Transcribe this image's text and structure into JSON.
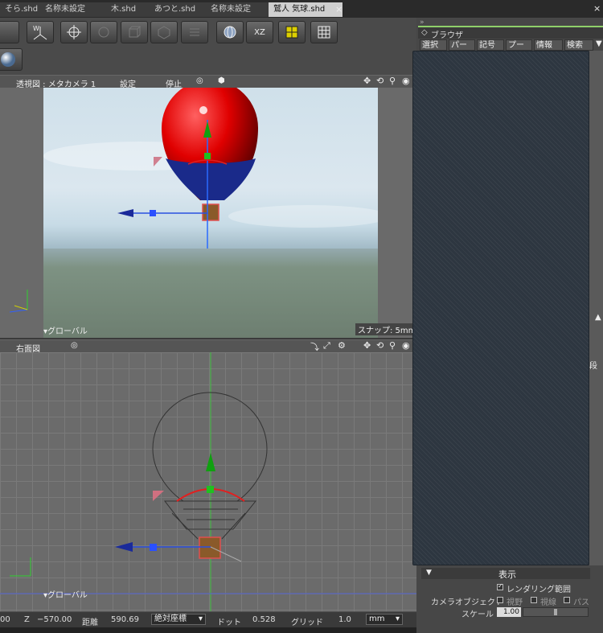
{
  "tabs": [
    {
      "label": "そら.shd"
    },
    {
      "label": "名称未設定"
    },
    {
      "label": "木.shd"
    },
    {
      "label": "あつと.shd"
    },
    {
      "label": "名称未設定"
    },
    {
      "label": "鷲人 気球.shd"
    }
  ],
  "tab_close": "×",
  "window_close": "×",
  "toolbar": {
    "xz_label": "XZ",
    "w_label": "W"
  },
  "perspective_view": {
    "title": "透視図 : メタカメラ 1",
    "settings_label": "設定",
    "stop_label": "停止",
    "coord_mode": "▾グローバル",
    "snap_label": "スナップ: 5mm"
  },
  "right_view": {
    "title": "右面図",
    "coord_mode": "▾グローバル"
  },
  "status_bar": {
    "left_value": "00",
    "z_label": "Z",
    "z_value": "−570.00",
    "distance_label": "距離",
    "distance_value": "590.69",
    "coord_mode": "絶対座標",
    "dot_label": "ドット",
    "dot_value": "0.528",
    "grid_label": "グリッド",
    "grid_value": "1.0",
    "unit": "mm"
  },
  "browser": {
    "title": "ブラウザ",
    "tabs": [
      {
        "label": "選択"
      },
      {
        "label": "パー"
      },
      {
        "label": "記号"
      },
      {
        "label": "プー"
      },
      {
        "label": "情報"
      },
      {
        "label": "検索"
      }
    ]
  },
  "display_panel": {
    "title": "表示",
    "rendering_range": "レンダリング範囲",
    "rendering_range_checked": true,
    "camera_object_label": "カメラオブジェクト",
    "view_label": "視野",
    "line_of_sight_label": "視線",
    "path_label": "パス",
    "scale_label": "スケール",
    "scale_value": "1.00"
  },
  "right_edge": {
    "label_1": "段"
  },
  "colors": {
    "active_tab": "#cfcfcf",
    "browser_accent": "#8fd06a",
    "balloon_red": "#e00000",
    "balloon_blue": "#1a2a8a"
  }
}
